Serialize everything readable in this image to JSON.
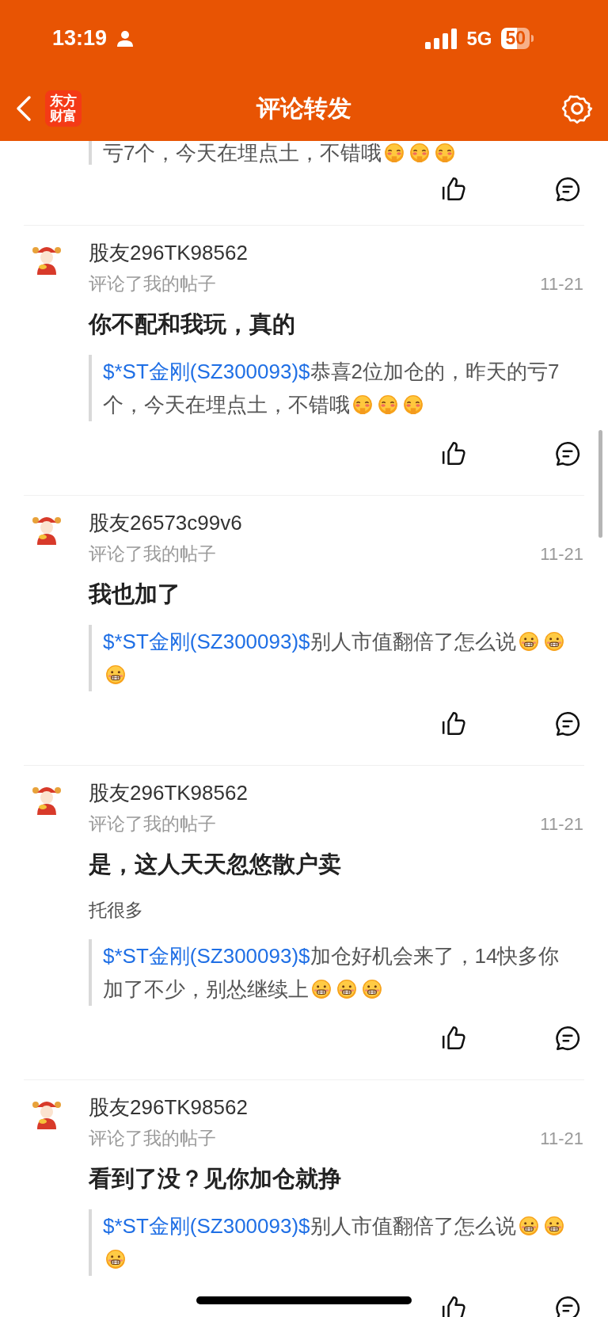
{
  "status_bar": {
    "time": "13:19",
    "network": "5G",
    "battery": "50"
  },
  "nav": {
    "logo": "东方财富",
    "title": "评论转发"
  },
  "partial_comment": {
    "quote_text": "亏7个，今天在埋点土，不错哦",
    "emojis": [
      {
        "kind": "blush"
      },
      {
        "kind": "blush"
      },
      {
        "kind": "blush"
      }
    ]
  },
  "comments": [
    {
      "user": "股友296TK98562",
      "action": "评论了我的帖子",
      "date": "11-21",
      "content": "你不配和我玩，真的",
      "quote": {
        "stock": "$*ST金刚(SZ300093)$",
        "text": "恭喜2位加仓的，昨天的亏7个，今天在埋点土，不错哦",
        "emojis": [
          {
            "kind": "blush"
          },
          {
            "kind": "blush"
          },
          {
            "kind": "blush"
          }
        ]
      }
    },
    {
      "user": "股友26573c99v6",
      "action": "评论了我的帖子",
      "date": "11-21",
      "content": "我也加了",
      "quote": {
        "stock": "$*ST金刚(SZ300093)$",
        "text": "别人市值翻倍了怎么说",
        "emojis": [
          {
            "kind": "grin"
          },
          {
            "kind": "grin"
          },
          {
            "kind": "grin"
          }
        ]
      }
    },
    {
      "user": "股友296TK98562",
      "action": "评论了我的帖子",
      "date": "11-21",
      "content": "是，这人天天忽悠散户卖",
      "note": "托很多",
      "quote": {
        "stock": "$*ST金刚(SZ300093)$",
        "text": "加仓好机会来了，14快多你加了不少，别怂继续上",
        "emojis": [
          {
            "kind": "grin"
          },
          {
            "kind": "grin"
          },
          {
            "kind": "grin"
          }
        ]
      }
    },
    {
      "user": "股友296TK98562",
      "action": "评论了我的帖子",
      "date": "11-21",
      "content": "看到了没？见你加仓就挣",
      "quote": {
        "stock": "$*ST金刚(SZ300093)$",
        "text": "别人市值翻倍了怎么说",
        "emojis": [
          {
            "kind": "grin"
          },
          {
            "kind": "grin"
          },
          {
            "kind": "grin"
          }
        ]
      }
    }
  ]
}
